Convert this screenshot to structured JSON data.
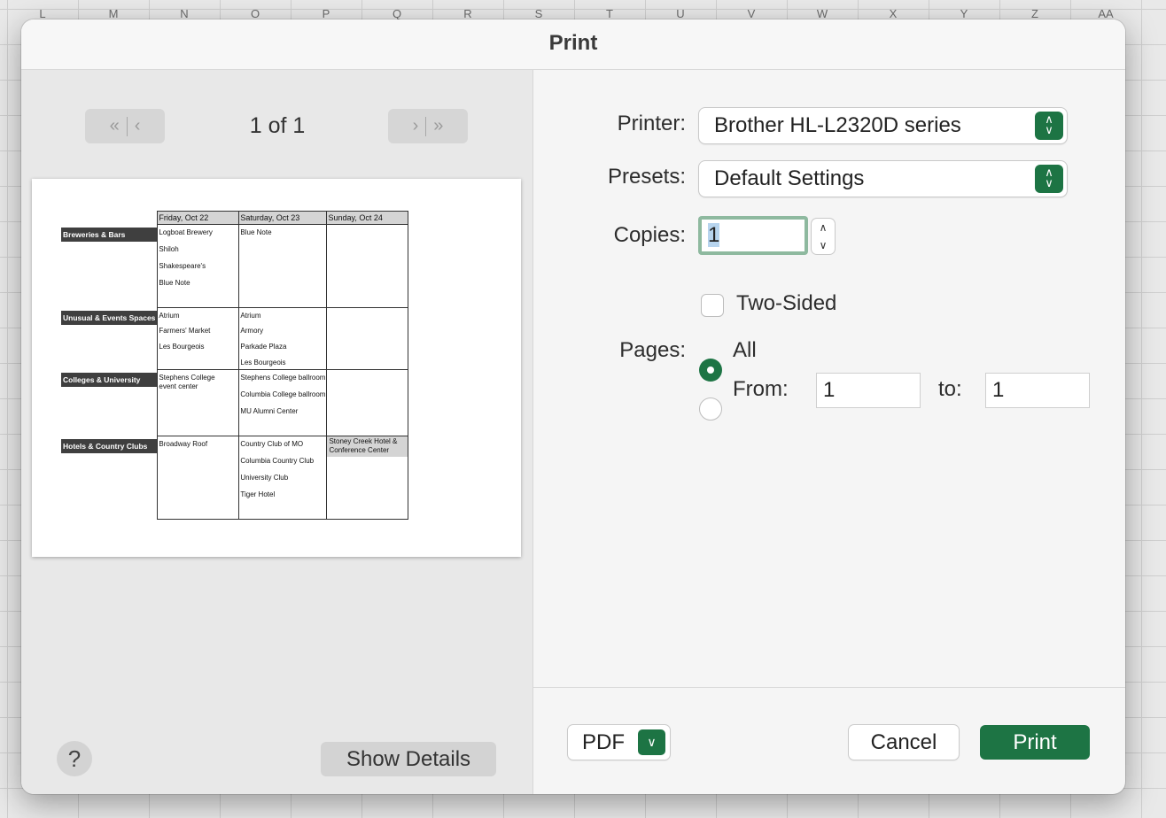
{
  "spreadsheet": {
    "column_headers": [
      "L",
      "M",
      "N",
      "O",
      "P",
      "Q",
      "R",
      "S",
      "T",
      "U",
      "V",
      "W",
      "X",
      "Y",
      "Z",
      "AA"
    ]
  },
  "dialog": {
    "title": "Print",
    "preview": {
      "page_indicator": "1 of 1",
      "first_icon": "double-chevron-left-icon",
      "prev_icon": "chevron-left-icon",
      "next_icon": "chevron-right-icon",
      "last_icon": "double-chevron-right-icon",
      "sheet": {
        "days": [
          "Friday, Oct 22",
          "Saturday, Oct 23",
          "Sunday, Oct 24"
        ],
        "rows": [
          {
            "category": "Breweries & Bars",
            "fri": [
              "Logboat Brewery",
              "Shiloh",
              "Shakespeare's",
              "Blue Note"
            ],
            "sat": [
              "Blue Note"
            ],
            "sun": []
          },
          {
            "category": "Unusual & Events Spaces",
            "fri": [
              "Atrium",
              "Farmers' Market",
              "Les Bourgeois"
            ],
            "sat": [
              "Atrium",
              "Armory",
              "Parkade Plaza",
              "Les Bourgeois"
            ],
            "sun": []
          },
          {
            "category": "Colleges & University",
            "fri": [
              "Stephens College event center"
            ],
            "sat": [
              "Stephens College ballroom",
              "Columbia College ballroom",
              "MU Alumni Center"
            ],
            "sun": []
          },
          {
            "category": "Hotels & Country Clubs",
            "fri": [
              "Broadway Roof"
            ],
            "sat": [
              "Country Club of MO",
              "Columbia Country Club",
              "University Club",
              "Tiger Hotel"
            ],
            "sun": [
              "Stoney Creek Hotel & Conference Center"
            ]
          }
        ]
      }
    },
    "help_label": "?",
    "show_details_label": "Show Details",
    "settings": {
      "printer_label": "Printer:",
      "printer_value": "Brother HL-L2320D series",
      "presets_label": "Presets:",
      "presets_value": "Default Settings",
      "copies_label": "Copies:",
      "copies_value": "1",
      "two_sided_label": "Two-Sided",
      "two_sided_checked": false,
      "pages_label": "Pages:",
      "pages_all_label": "All",
      "pages_from_label": "From:",
      "pages_from_value": "1",
      "pages_to_label": "to:",
      "pages_to_value": "1",
      "selected_pages_option": "All"
    },
    "footer": {
      "pdf_label": "PDF",
      "cancel_label": "Cancel",
      "print_label": "Print"
    },
    "colors": {
      "accent": "#1d7444",
      "focus_ring": "#8eb99f"
    }
  }
}
